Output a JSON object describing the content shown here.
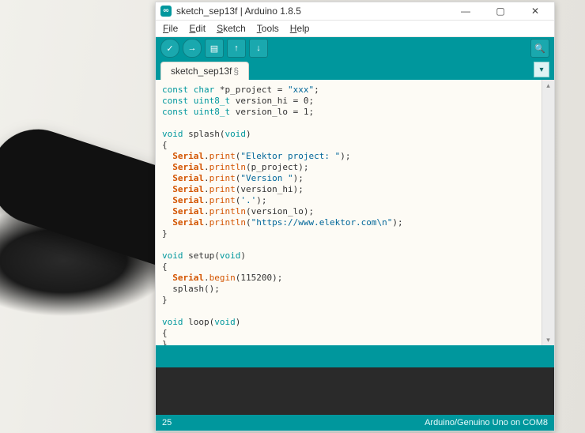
{
  "titlebar": {
    "title": "sketch_sep13f | Arduino 1.8.5"
  },
  "menu": {
    "file": "File",
    "edit": "Edit",
    "sketch": "Sketch",
    "tools": "Tools",
    "help": "Help"
  },
  "toolbar_icons": {
    "verify": "✓",
    "upload": "→",
    "new": "▤",
    "open": "↑",
    "save": "↓",
    "monitor": "🔍"
  },
  "tab": {
    "name": "sketch_sep13f",
    "modified_marker": "§"
  },
  "code": {
    "tokens": [
      [
        [
          "kw",
          "const"
        ],
        [
          "sp",
          " "
        ],
        [
          "type",
          "char"
        ],
        [
          "pl",
          " *p_project = "
        ],
        [
          "str",
          "\"xxx\""
        ],
        [
          "pl",
          ";"
        ]
      ],
      [
        [
          "kw",
          "const"
        ],
        [
          "sp",
          " "
        ],
        [
          "type",
          "uint8_t"
        ],
        [
          "pl",
          " version_hi = "
        ],
        [
          "num",
          "0"
        ],
        [
          "pl",
          ";"
        ]
      ],
      [
        [
          "kw",
          "const"
        ],
        [
          "sp",
          " "
        ],
        [
          "type",
          "uint8_t"
        ],
        [
          "pl",
          " version_lo = "
        ],
        [
          "num",
          "1"
        ],
        [
          "pl",
          ";"
        ]
      ],
      [],
      [
        [
          "kw",
          "void"
        ],
        [
          "pl",
          " splash("
        ],
        [
          "kw",
          "void"
        ],
        [
          "pl",
          ")"
        ]
      ],
      [
        [
          "pl",
          "{"
        ]
      ],
      [
        [
          "pl",
          "  "
        ],
        [
          "obj",
          "Serial"
        ],
        [
          "pl",
          "."
        ],
        [
          "fn",
          "print"
        ],
        [
          "pl",
          "("
        ],
        [
          "str",
          "\"Elektor project: \""
        ],
        [
          "pl",
          ");"
        ]
      ],
      [
        [
          "pl",
          "  "
        ],
        [
          "obj",
          "Serial"
        ],
        [
          "pl",
          "."
        ],
        [
          "fn",
          "println"
        ],
        [
          "pl",
          "(p_project);"
        ]
      ],
      [
        [
          "pl",
          "  "
        ],
        [
          "obj",
          "Serial"
        ],
        [
          "pl",
          "."
        ],
        [
          "fn",
          "print"
        ],
        [
          "pl",
          "("
        ],
        [
          "str",
          "\"Version \""
        ],
        [
          "pl",
          ");"
        ]
      ],
      [
        [
          "pl",
          "  "
        ],
        [
          "obj",
          "Serial"
        ],
        [
          "pl",
          "."
        ],
        [
          "fn",
          "print"
        ],
        [
          "pl",
          "(version_hi);"
        ]
      ],
      [
        [
          "pl",
          "  "
        ],
        [
          "obj",
          "Serial"
        ],
        [
          "pl",
          "."
        ],
        [
          "fn",
          "print"
        ],
        [
          "pl",
          "("
        ],
        [
          "str",
          "'.'"
        ],
        [
          "pl",
          ");"
        ]
      ],
      [
        [
          "pl",
          "  "
        ],
        [
          "obj",
          "Serial"
        ],
        [
          "pl",
          "."
        ],
        [
          "fn",
          "println"
        ],
        [
          "pl",
          "(version_lo);"
        ]
      ],
      [
        [
          "pl",
          "  "
        ],
        [
          "obj",
          "Serial"
        ],
        [
          "pl",
          "."
        ],
        [
          "fn",
          "println"
        ],
        [
          "pl",
          "("
        ],
        [
          "str",
          "\"https://www.elektor.com\\n\""
        ],
        [
          "pl",
          ");"
        ]
      ],
      [
        [
          "pl",
          "}"
        ]
      ],
      [],
      [
        [
          "kw",
          "void"
        ],
        [
          "pl",
          " setup("
        ],
        [
          "kw",
          "void"
        ],
        [
          "pl",
          ")"
        ]
      ],
      [
        [
          "pl",
          "{"
        ]
      ],
      [
        [
          "pl",
          "  "
        ],
        [
          "obj",
          "Serial"
        ],
        [
          "pl",
          "."
        ],
        [
          "fn",
          "begin"
        ],
        [
          "pl",
          "("
        ],
        [
          "num",
          "115200"
        ],
        [
          "pl",
          ");"
        ]
      ],
      [
        [
          "pl",
          "  splash();"
        ]
      ],
      [
        [
          "pl",
          "}"
        ]
      ],
      [],
      [
        [
          "kw",
          "void"
        ],
        [
          "pl",
          " loop("
        ],
        [
          "kw",
          "void"
        ],
        [
          "pl",
          ")"
        ]
      ],
      [
        [
          "pl",
          "{"
        ]
      ],
      [
        [
          "pl",
          "}"
        ]
      ]
    ]
  },
  "status": {
    "line": "25",
    "board": "Arduino/Genuino Uno on COM8"
  }
}
